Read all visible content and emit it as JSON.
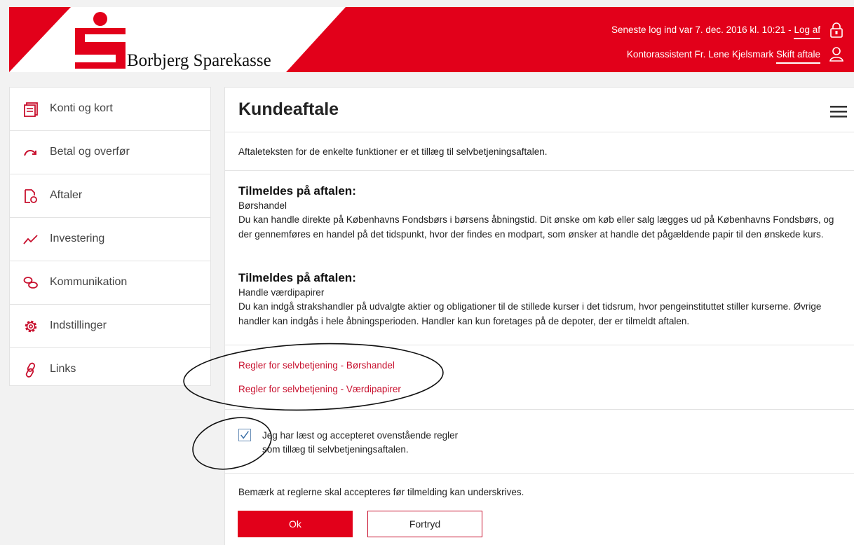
{
  "brand": {
    "name": "Borbjerg Sparekasse",
    "primary_color": "#e2001a"
  },
  "header": {
    "last_login_text": "Seneste log ind var 7. dec. 2016 kl. 10:21 -",
    "logout_label": "Log af",
    "user_text": "Kontorassistent Fr. Lene Kjelsmark",
    "switch_agreement_label": "Skift aftale",
    "icons": [
      "lock-icon",
      "user-icon"
    ]
  },
  "sidebar": {
    "items": [
      {
        "label": "Konti og kort",
        "icon": "account-cards-icon"
      },
      {
        "label": "Betal og overfør",
        "icon": "transfer-arrow-icon"
      },
      {
        "label": "Aftaler",
        "icon": "agreement-document-icon"
      },
      {
        "label": "Investering",
        "icon": "investment-chart-icon"
      },
      {
        "label": "Kommunikation",
        "icon": "chat-bubbles-icon"
      },
      {
        "label": "Indstillinger",
        "icon": "gear-icon"
      },
      {
        "label": "Links",
        "icon": "link-icon"
      }
    ]
  },
  "main": {
    "title": "Kundeaftale",
    "intro": "Aftaleteksten for de enkelte funktioner er et tillæg til selvbetjeningsaftalen.",
    "sections": [
      {
        "heading": "Tilmeldes på aftalen:",
        "subtitle": "Børshandel",
        "body": "Du kan handle direkte på Københavns Fondsbørs i børsens åbningstid. Dit ønske om køb eller salg lægges ud på Københavns Fondsbørs, og der gennemføres en handel på det tidspunkt, hvor der findes en modpart, som ønsker at handle det pågældende papir til den ønskede kurs."
      },
      {
        "heading": "Tilmeldes på aftalen:",
        "subtitle": "Handle værdipapirer",
        "body": "Du kan indgå strakshandler på udvalgte aktier og obligationer til de stillede kurser i det tidsrum, hvor pengeinstituttet stiller kurserne. Øvrige handler kan indgås i hele åbningsperioden. Handler kan kun foretages på de depoter, der er tilmeldt aftalen."
      }
    ],
    "rule_links": [
      "Regler for selvbetjening - Børshandel",
      "Regler for selvbetjening - Værdipapirer"
    ],
    "accept": {
      "checked": true,
      "line1": "Jeg har læst og accepteret ovenstående regler",
      "line2": "som tillæg til selvbetjeningsaftalen."
    },
    "note": "Bemærk at reglerne skal accepteres før tilmelding kan underskrives.",
    "ok_label": "Ok",
    "cancel_label": "Fortryd"
  }
}
